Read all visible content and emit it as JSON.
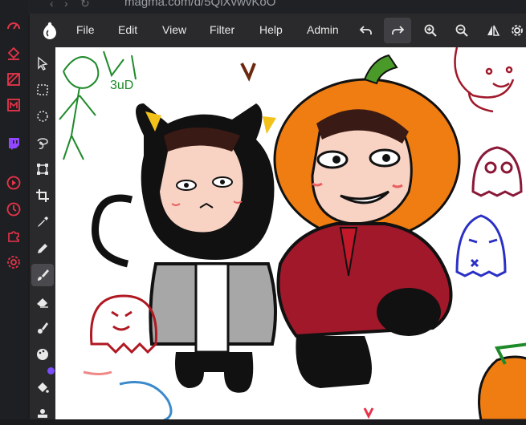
{
  "browser": {
    "url": "magma.com/d/5QiXvwvKoO"
  },
  "sidebar": {
    "icons": [
      "dashboard-icon",
      "paint-bucket-icon",
      "image-off-icon",
      "mail-m-icon",
      "twitch-icon",
      "play-circle-icon",
      "clock-icon",
      "puzzle-icon",
      "settings-icon"
    ]
  },
  "app": {
    "menu": [
      "File",
      "Edit",
      "View",
      "Filter",
      "Help",
      "Admin"
    ]
  },
  "toolbar": {
    "undo": "undo-icon",
    "redo": "redo-icon",
    "zoom_in": "zoom-in-icon",
    "zoom_out": "zoom-out-icon",
    "flip": "flip-icon"
  },
  "tools": [
    "move",
    "rect-select",
    "ellipse-select",
    "lasso",
    "transform",
    "crop",
    "eyedropper",
    "pencil",
    "brush",
    "eraser",
    "smudge",
    "color",
    "fill",
    "stamp"
  ],
  "colors": {
    "accent": "#e8344a",
    "twitch": "#9146ff",
    "menubar": "#2a2a2c",
    "pumpkin": "#ef7d12"
  },
  "canvas": {
    "doodle_text": "3uD"
  }
}
